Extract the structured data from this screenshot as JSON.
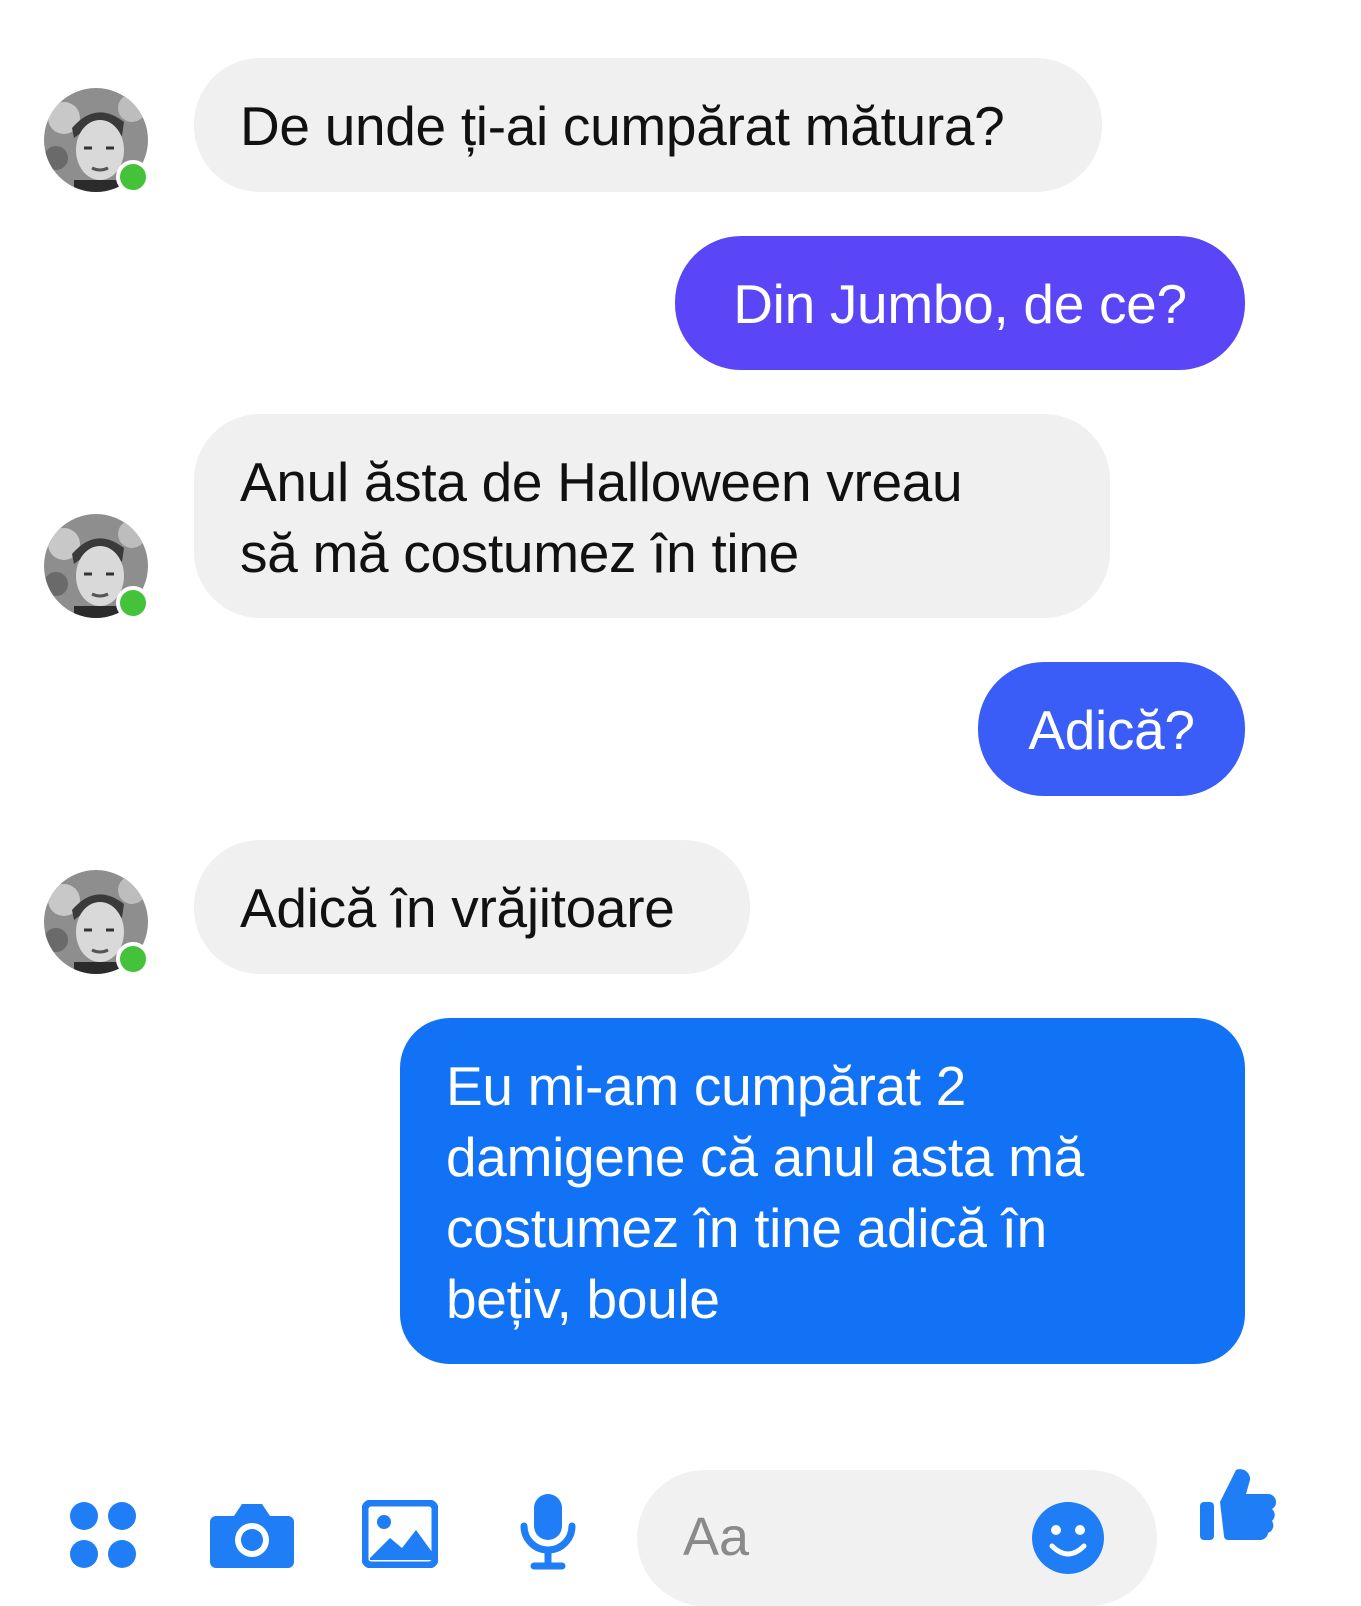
{
  "colors": {
    "incoming_bubble": "#f0f0f0",
    "outgoing_purple": "#5a45f7",
    "outgoing_indigo": "#3a5cf7",
    "outgoing_blue": "#1272f6",
    "accent_icon": "#1f7df5",
    "online": "#44c23a"
  },
  "messages": [
    {
      "direction": "in",
      "text": "De unde ți-ai cumpărat mătura?"
    },
    {
      "direction": "out",
      "text": "Din Jumbo, de ce?"
    },
    {
      "direction": "in",
      "text": "Anul ăsta de Halloween vreau\nsă mă costumez în tine"
    },
    {
      "direction": "out",
      "text": "Adică?"
    },
    {
      "direction": "in",
      "text": "Adică în vrăjitoare"
    },
    {
      "direction": "out",
      "text": "Eu mi-am cumpărat 2\ndamigene că anul asta mă\ncostumez în tine adică în\nbețiv, boule"
    }
  ],
  "composer": {
    "placeholder": "Aa",
    "icons": [
      "menu-dots-icon",
      "camera-icon",
      "gallery-icon",
      "microphone-icon",
      "emoji-icon",
      "thumbs-up-icon"
    ]
  }
}
